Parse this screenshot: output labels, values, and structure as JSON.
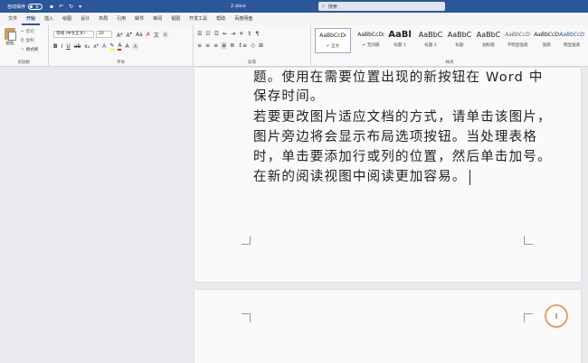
{
  "titlebar": {
    "autosave_label": "自动保存",
    "autosave_state": "关",
    "doc_name": "2.docx",
    "search_placeholder": "搜索"
  },
  "tabs": [
    "文件",
    "开始",
    "插入",
    "绘图",
    "设计",
    "布局",
    "引用",
    "邮件",
    "审阅",
    "视图",
    "开发工具",
    "帮助",
    "百度网盘"
  ],
  "active_tab": "开始",
  "ribbon": {
    "clipboard": {
      "paste": "粘贴",
      "cut": "剪切",
      "copy": "复制",
      "format_painter": "格式刷",
      "label": "剪贴板"
    },
    "font": {
      "font_name": "等线 (中文正文)",
      "font_size": "20",
      "label": "字体"
    },
    "paragraph": {
      "label": "段落"
    },
    "styles": {
      "label": "样式",
      "items": [
        {
          "preview": "AaBbCcDı",
          "name": "↵ 正文"
        },
        {
          "preview": "AaBbCcDı",
          "name": "↵ 无间隔"
        },
        {
          "preview": "AaBl",
          "name": "标题 1"
        },
        {
          "preview": "AaBbC",
          "name": "标题 2"
        },
        {
          "preview": "AaBbC",
          "name": "标题"
        },
        {
          "preview": "AaBbC",
          "name": "副标题"
        },
        {
          "preview": "AaBbCcD",
          "name": "不明显强调"
        },
        {
          "preview": "AaBbCcD",
          "name": "强调"
        },
        {
          "preview": "AaBbCcD",
          "name": "明显强调"
        }
      ]
    }
  },
  "document": {
    "page1_lines": [
      "题。使用在需要位置出现的新按钮在 Word 中",
      "保存时间。",
      "若要更改图片适应文档的方式，请单击该图片，",
      "图片旁边将会显示布局选项按钮。当处理表格",
      "时，单击要添加行或列的位置，然后单击加号。",
      "在新的阅读视图中阅读更加容易。"
    ]
  },
  "colors": {
    "accent": "#2b579a",
    "page": "#fafaf8",
    "canvas": "#e9ebee"
  }
}
